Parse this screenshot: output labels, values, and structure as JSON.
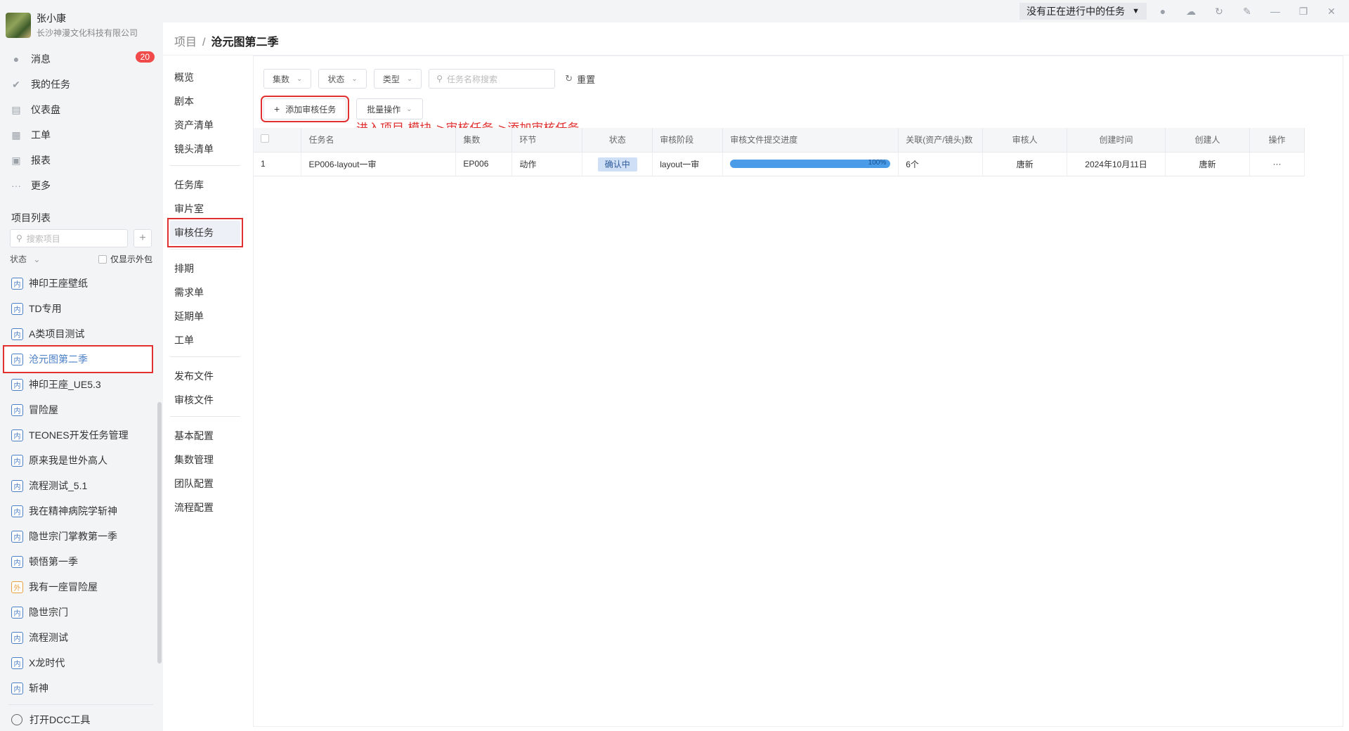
{
  "user": {
    "name": "张小康",
    "company": "长沙神漫文化科技有限公司"
  },
  "nav": [
    {
      "label": "消息",
      "icon": "message-icon",
      "badge": "20"
    },
    {
      "label": "我的任务",
      "icon": "check-icon"
    },
    {
      "label": "仪表盘",
      "icon": "dashboard-icon"
    },
    {
      "label": "工单",
      "icon": "ticket-icon"
    },
    {
      "label": "报表",
      "icon": "report-icon"
    },
    {
      "label": "更多",
      "icon": "more-icon"
    }
  ],
  "project_list": {
    "title": "项目列表",
    "search_placeholder": "搜索项目",
    "add_label": "+",
    "filter_label": "状态",
    "outsource_label": "仅显示外包",
    "items": [
      {
        "tag": "内",
        "name": "神印王座壁纸"
      },
      {
        "tag": "内",
        "name": "TD专用"
      },
      {
        "tag": "内",
        "name": "A类项目测试"
      },
      {
        "tag": "内",
        "name": "沧元图第二季",
        "active": true
      },
      {
        "tag": "内",
        "name": "神印王座_UE5.3"
      },
      {
        "tag": "内",
        "name": "冒险屋"
      },
      {
        "tag": "内",
        "name": "TEONES开发任务管理"
      },
      {
        "tag": "内",
        "name": "原来我是世外高人"
      },
      {
        "tag": "内",
        "name": "流程测试_5.1"
      },
      {
        "tag": "内",
        "name": "我在精神病院学斩神"
      },
      {
        "tag": "内",
        "name": "隐世宗门掌教第一季"
      },
      {
        "tag": "内",
        "name": "顿悟第一季"
      },
      {
        "tag": "外",
        "name": "我有一座冒险屋"
      },
      {
        "tag": "内",
        "name": "隐世宗门"
      },
      {
        "tag": "内",
        "name": "流程测试"
      },
      {
        "tag": "内",
        "name": "X龙时代"
      },
      {
        "tag": "内",
        "name": "斩神"
      }
    ],
    "dcc_label": "打开DCC工具"
  },
  "titlebar": {
    "task_status": "没有正在进行中的任务"
  },
  "breadcrumb": {
    "root": "项目",
    "sep": "/",
    "current": "沧元图第二季"
  },
  "subnav": [
    [
      "概览",
      "剧本",
      "资产清单",
      "镜头清单"
    ],
    [
      "任务库",
      "审片室",
      "审核任务"
    ],
    [
      "排期",
      "需求单",
      "延期单",
      "工单"
    ],
    [
      "发布文件",
      "审核文件"
    ],
    [
      "基本配置",
      "集数管理",
      "团队配置",
      "流程配置"
    ]
  ],
  "filters": {
    "episode": "集数",
    "status": "状态",
    "type": "类型",
    "search_placeholder": "任务名称搜索",
    "reset": "重置"
  },
  "toolbar": {
    "add": "添加审核任务",
    "batch": "批量操作"
  },
  "annotation": "进入项目 模块->审核任务->添加审核任务",
  "table": {
    "headers": [
      "任务名",
      "集数",
      "环节",
      "状态",
      "审核阶段",
      "审核文件提交进度",
      "关联(资产/镜头)数",
      "审核人",
      "创建时间",
      "创建人",
      "操作"
    ],
    "rows": [
      {
        "index": "1",
        "name": "EP006-layout一审",
        "episode": "EP006",
        "step": "动作",
        "status": "确认中",
        "stage": "layout一审",
        "progress_label": "100%",
        "progress": 1.0,
        "related": "6个",
        "reviewer": "唐新",
        "created": "2024年10月11日",
        "creator": "唐新",
        "action": "···"
      }
    ]
  }
}
